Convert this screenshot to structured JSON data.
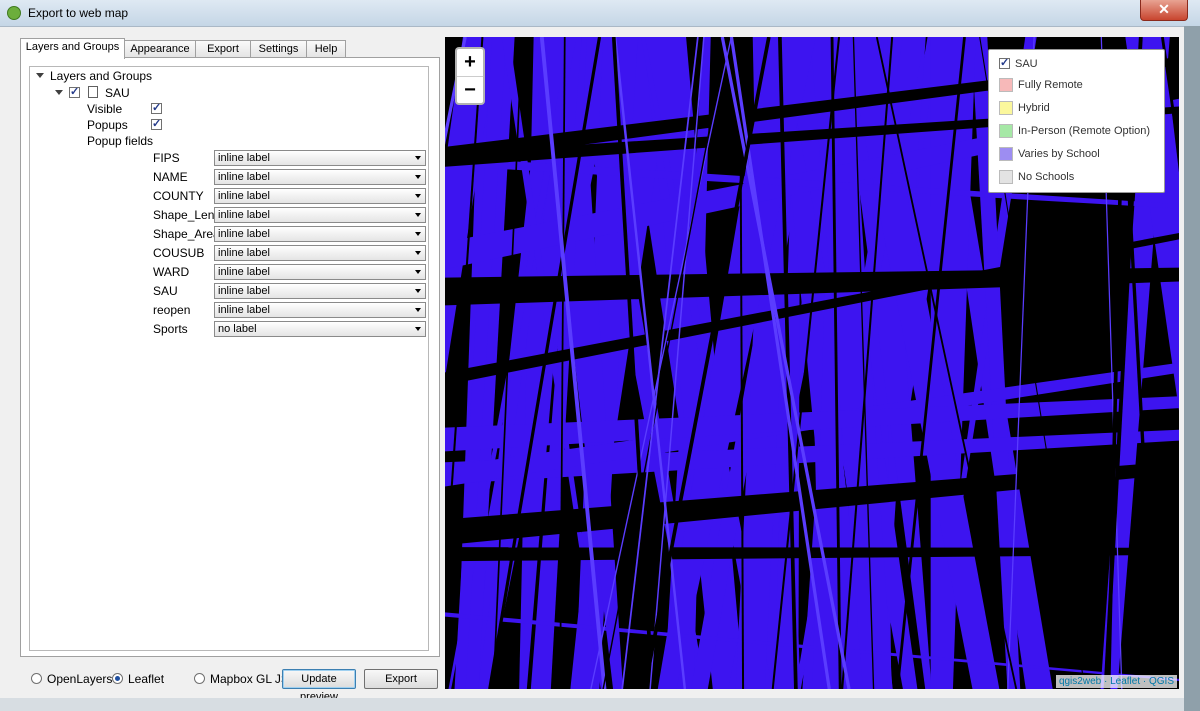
{
  "window": {
    "title": "Export to web map",
    "close_glyph": "✕"
  },
  "tabs": [
    "Layers and Groups",
    "Appearance",
    "Export",
    "Settings",
    "Help"
  ],
  "tree": {
    "root_label": "Layers and Groups",
    "layer_label": "SAU",
    "visible_label": "Visible",
    "popups_label": "Popups",
    "popup_fields_label": "Popup fields",
    "fields": [
      {
        "name": "FIPS",
        "value": "inline label"
      },
      {
        "name": "NAME",
        "value": "inline label"
      },
      {
        "name": "COUNTY",
        "value": "inline label"
      },
      {
        "name": "Shape_Leng",
        "value": "inline label"
      },
      {
        "name": "Shape_Area",
        "value": "inline label"
      },
      {
        "name": "COUSUB",
        "value": "inline label"
      },
      {
        "name": "WARD",
        "value": "inline label"
      },
      {
        "name": "SAU",
        "value": "inline label"
      },
      {
        "name": "reopen",
        "value": "inline label"
      },
      {
        "name": "Sports",
        "value": "no label"
      }
    ]
  },
  "bottom": {
    "openlayers": "OpenLayers",
    "leaflet": "Leaflet",
    "mapbox": "Mapbox GL JS",
    "update_preview": "Update preview",
    "export": "Export",
    "selected": "Leaflet"
  },
  "map": {
    "zoom_in": "+",
    "zoom_out": "−",
    "fill_color": "#3d14f0",
    "background_color": "#000000",
    "attribution": "qgis2web · Leaflet · QGIS",
    "legend": {
      "layer": "SAU",
      "items": [
        {
          "label": "Fully Remote",
          "color": "#f7b9b9"
        },
        {
          "label": "Hybrid",
          "color": "#fbf79c"
        },
        {
          "label": "In-Person (Remote Option)",
          "color": "#a6e8a6"
        },
        {
          "label": "Varies by School",
          "color": "#9d8df2"
        },
        {
          "label": "No Schools",
          "color": "#e3e3e3"
        }
      ]
    }
  }
}
